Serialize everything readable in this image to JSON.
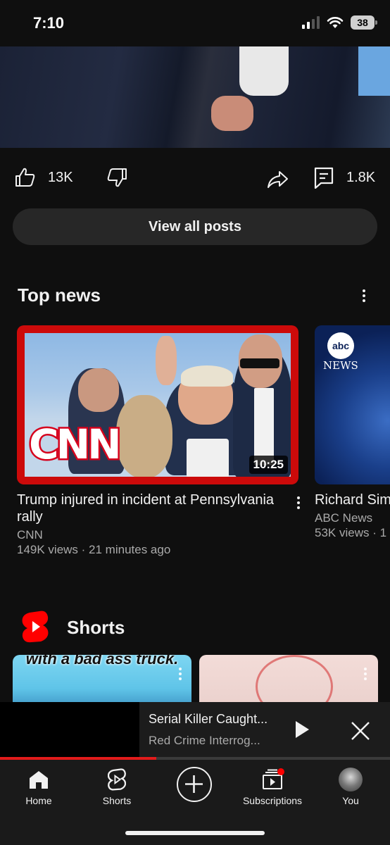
{
  "status_bar": {
    "time": "7:10",
    "battery": "38"
  },
  "post": {
    "likes": "13K",
    "comments": "1.8K",
    "view_all_label": "View all posts"
  },
  "top_news": {
    "title": "Top news",
    "videos": [
      {
        "title": "Trump injured in incident at Pennsylvania rally",
        "channel": "CNN",
        "meta": "149K views · 21 minutes ago",
        "duration": "10:25",
        "logo_text": "CNN"
      },
      {
        "title": "Richard Sim",
        "channel": "ABC News",
        "meta": "53K views · 1",
        "logo_abc": "abc",
        "logo_news": "NEWS"
      }
    ]
  },
  "shorts": {
    "title": "Shorts",
    "items": [
      {
        "caption": "with a bad ass truck."
      },
      {
        "caption": ""
      }
    ]
  },
  "mini_player": {
    "title": "Serial Killer Caught...",
    "subtitle": "Red Crime Interrog...",
    "progress": 0.4
  },
  "nav": {
    "items": [
      {
        "label": "Home",
        "icon": "home-icon"
      },
      {
        "label": "Shorts",
        "icon": "shorts-icon"
      },
      {
        "label": "",
        "icon": "create-icon"
      },
      {
        "label": "Subscriptions",
        "icon": "subscriptions-icon"
      },
      {
        "label": "You",
        "icon": "avatar"
      }
    ]
  },
  "colors": {
    "accent": "#cc0a0a",
    "background": "#0f0f0f",
    "progress": "#e21b1b"
  }
}
